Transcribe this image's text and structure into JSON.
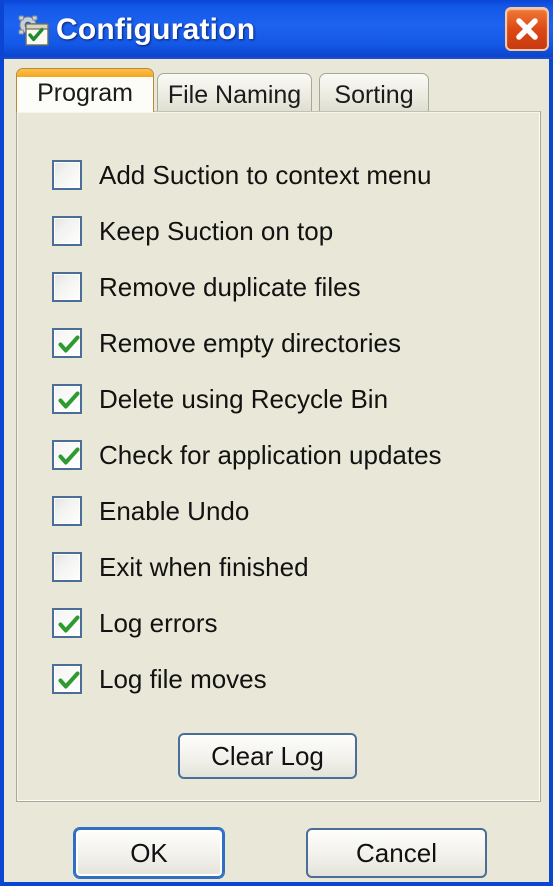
{
  "window": {
    "title": "Configuration",
    "icon": "gear-checklist-icon",
    "close_icon": "close-icon",
    "accent_color": "#0A46D2",
    "titlebar_color": "#1358E8",
    "body_color": "#E9E8D8",
    "close_button_color": "#DF4A16"
  },
  "tabs": [
    {
      "label": "Program",
      "active": true,
      "accent": "#F5A623"
    },
    {
      "label": "File Naming",
      "active": false,
      "accent": ""
    },
    {
      "label": "Sorting",
      "active": false,
      "accent": ""
    }
  ],
  "program_tab": {
    "options": [
      {
        "label": "Add Suction to context menu",
        "checked": false
      },
      {
        "label": "Keep Suction on top",
        "checked": false
      },
      {
        "label": "Remove duplicate files",
        "checked": false
      },
      {
        "label": "Remove empty directories",
        "checked": true
      },
      {
        "label": "Delete using Recycle Bin",
        "checked": true
      },
      {
        "label": "Check for application updates",
        "checked": true
      },
      {
        "label": "Enable Undo",
        "checked": false
      },
      {
        "label": "Exit when finished",
        "checked": false
      },
      {
        "label": "Log errors",
        "checked": true
      },
      {
        "label": "Log file moves",
        "checked": true
      }
    ],
    "clear_log_label": "Clear Log",
    "check_color": "#2E9B2E"
  },
  "footer": {
    "ok_label": "OK",
    "cancel_label": "Cancel"
  }
}
